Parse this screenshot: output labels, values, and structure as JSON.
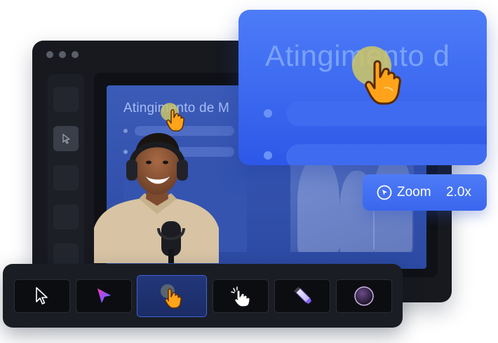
{
  "slide": {
    "title": "Atingimento de M"
  },
  "zoom_preview": {
    "title": "Atingimento d"
  },
  "zoom_badge": {
    "label": "Zoom",
    "value": "2.0x"
  },
  "toolbar": {
    "tools": [
      {
        "name": "cursor-tool",
        "icon": "arrow-cursor-icon"
      },
      {
        "name": "laser-pointer-tool",
        "icon": "gradient-pointer-icon"
      },
      {
        "name": "highlight-hand-tool",
        "icon": "pointing-hand-icon",
        "selected": true
      },
      {
        "name": "click-hand-tool",
        "icon": "tap-hand-icon"
      },
      {
        "name": "pen-tool",
        "icon": "marker-icon"
      },
      {
        "name": "spotlight-tool",
        "icon": "circle-spotlight-icon"
      }
    ]
  },
  "colors": {
    "accent": "#3a66ee",
    "window_bg": "#17191f",
    "slide_bg": "#3c5bb8",
    "selected_tool_border": "#4064d8"
  }
}
